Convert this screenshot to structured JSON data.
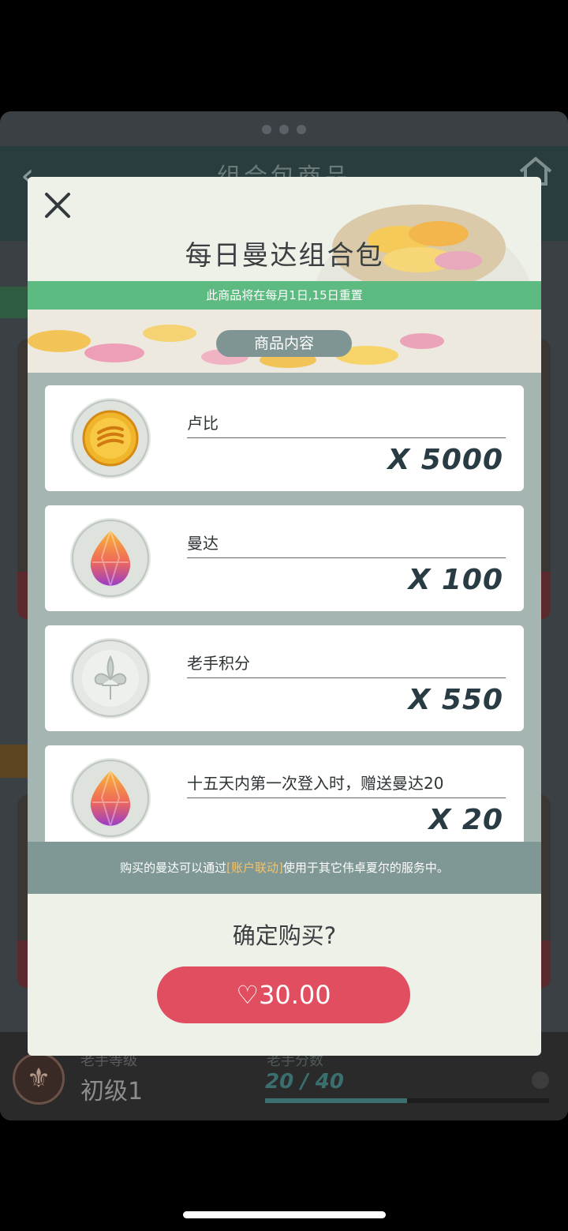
{
  "background": {
    "title": "组合包商品",
    "level_label": "老手等级",
    "level_value": "初级1",
    "score_label": "老手分数",
    "score_value": "20 / 40",
    "score_progress": 0.5
  },
  "modal": {
    "title": "每日曼达组合包",
    "reset_notice": "此商品将在每月1日,15日重置",
    "section_label": "商品内容",
    "items": [
      {
        "name": "卢比",
        "quantity": "X 5000",
        "icon": "rupee-coin-icon"
      },
      {
        "name": "曼达",
        "quantity": "X 100",
        "icon": "manda-gem-icon"
      },
      {
        "name": "老手积分",
        "quantity": "X 550",
        "icon": "veteran-fleur-icon"
      },
      {
        "name": "十五天内第一次登入时，赠送曼达20",
        "quantity": "X 20",
        "icon": "manda-gem-icon"
      }
    ],
    "notice": {
      "before": "购买的曼达可以通过",
      "link": "[账户联动]",
      "after": "使用于其它伟卓夏尔的服务中。"
    },
    "confirm_question": "确定购买?",
    "buy_label": "♡30.00"
  },
  "colors": {
    "banner_green": "#5dbb81",
    "buy_red": "#e04e60",
    "link_gold": "#f2c36b"
  }
}
